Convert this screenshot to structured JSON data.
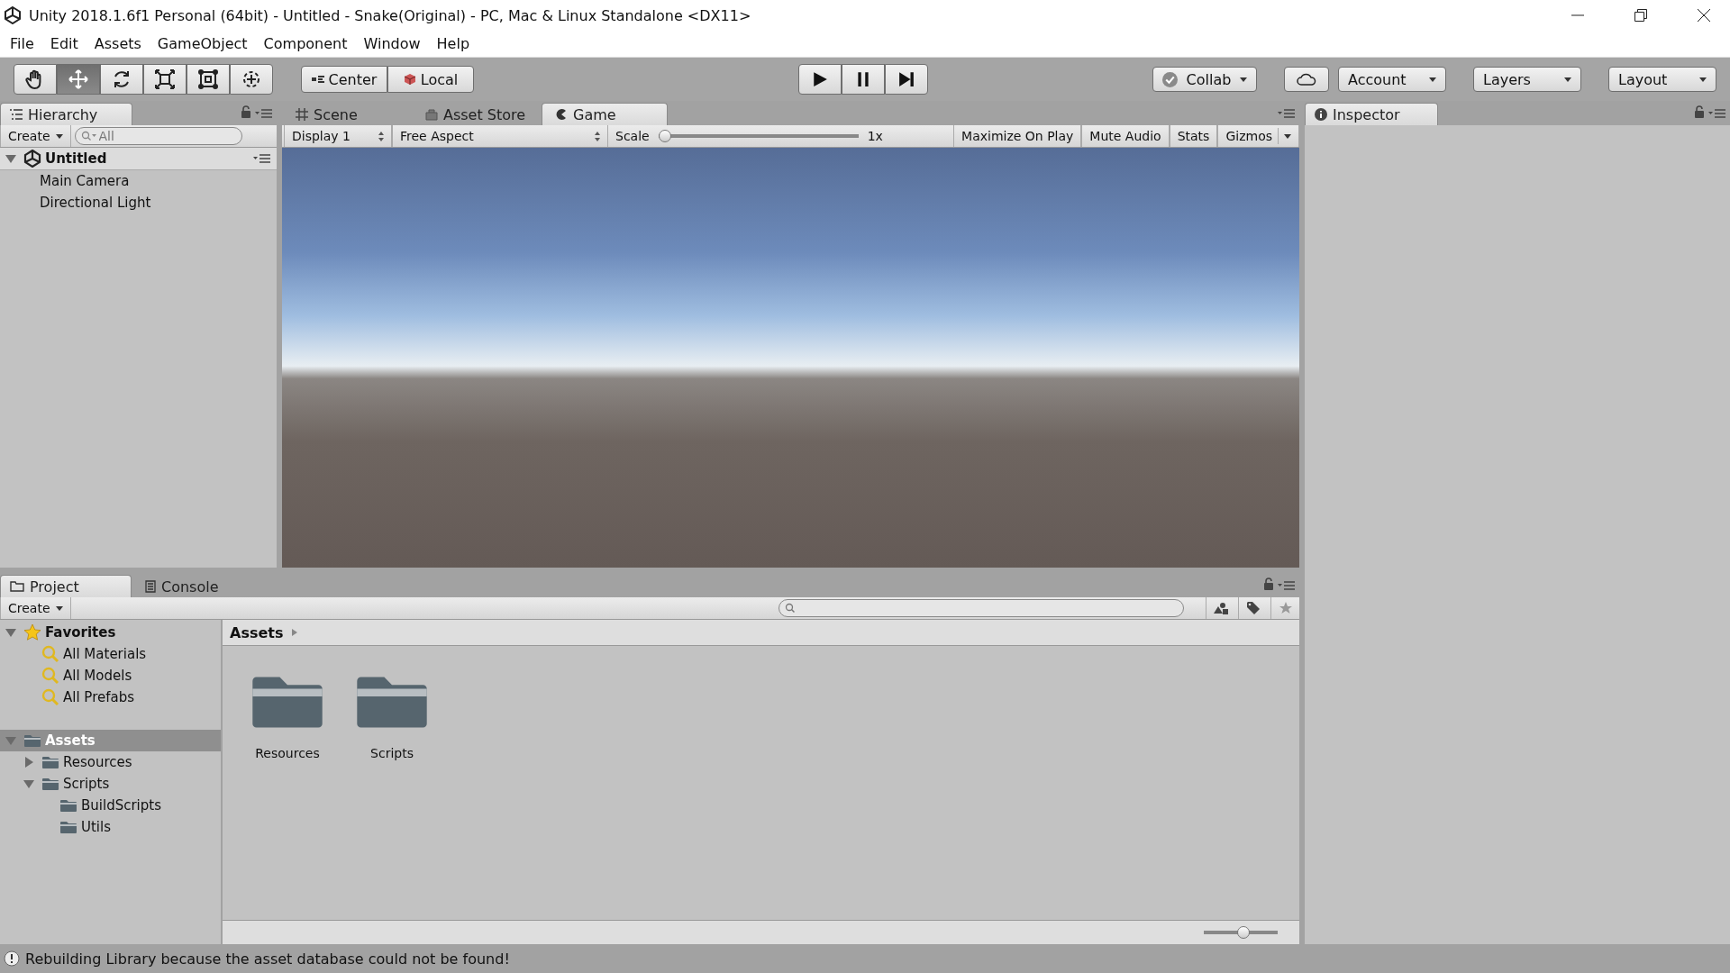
{
  "window": {
    "title": "Unity 2018.1.6f1 Personal (64bit) - Untitled - Snake(Original) - PC, Mac & Linux Standalone <DX11>"
  },
  "menu": [
    "File",
    "Edit",
    "Assets",
    "GameObject",
    "Component",
    "Window",
    "Help"
  ],
  "toolbar": {
    "tools": [
      {
        "selected": false
      },
      {
        "selected": true
      },
      {
        "selected": false
      },
      {
        "selected": false
      },
      {
        "selected": false
      },
      {
        "selected": false
      }
    ],
    "pivot": [
      "Center",
      "Local"
    ],
    "collab": "Collab",
    "account": "Account",
    "layers": "Layers",
    "layout": "Layout"
  },
  "hierarchy": {
    "tabs": [
      {
        "label": "Hierarchy",
        "selected": true
      }
    ],
    "create": "Create",
    "search": {
      "placeholder": "All"
    },
    "scene": {
      "label": "Untitled",
      "expanded": true,
      "selected": false,
      "children": [
        {
          "label": "Main Camera",
          "selected": false
        },
        {
          "label": "Directional Light",
          "selected": false
        }
      ]
    }
  },
  "game": {
    "tabs": [
      {
        "label": "Scene",
        "selected": false
      },
      {
        "label": "Asset Store",
        "selected": false
      },
      {
        "label": "Game",
        "selected": true
      }
    ],
    "display": "Display 1",
    "aspect": "Free Aspect",
    "scale": {
      "label": "Scale",
      "level": 0,
      "reading": "1x"
    },
    "toggles": [
      {
        "label": "Maximize On Play",
        "on": false
      },
      {
        "label": "Mute Audio",
        "on": false
      },
      {
        "label": "Stats",
        "on": false
      }
    ],
    "gizmos": {
      "label": "Gizmos",
      "on": false
    }
  },
  "inspector": {
    "tabs": [
      {
        "label": "Inspector",
        "selected": true
      }
    ]
  },
  "project": {
    "tabs": [
      {
        "label": "Project",
        "selected": true
      },
      {
        "label": "Console",
        "selected": false
      }
    ],
    "create": "Create",
    "breadcrumb": "Assets",
    "tree": [
      {
        "label": "Favorites",
        "kind": "favorites",
        "expanded": true,
        "selected": false,
        "children": [
          {
            "label": "All Materials",
            "kind": "search",
            "selected": false
          },
          {
            "label": "All Models",
            "kind": "search",
            "selected": false
          },
          {
            "label": "All Prefabs",
            "kind": "search",
            "selected": false
          }
        ]
      },
      {
        "label": "Assets",
        "kind": "folder",
        "expanded": true,
        "selected": true,
        "children": [
          {
            "label": "Resources",
            "kind": "folder",
            "expanded": false,
            "selected": false
          },
          {
            "label": "Scripts",
            "kind": "folder",
            "expanded": true,
            "selected": false,
            "children": [
              {
                "label": "BuildScripts",
                "kind": "folder",
                "selected": false
              },
              {
                "label": "Utils",
                "kind": "folder",
                "selected": false
              }
            ]
          }
        ]
      }
    ],
    "items": [
      {
        "label": "Resources"
      },
      {
        "label": "Scripts"
      }
    ],
    "zoom": {
      "level": 0.55
    }
  },
  "status_bar": {
    "message": "Rebuilding Library because the asset database could not be found!"
  }
}
